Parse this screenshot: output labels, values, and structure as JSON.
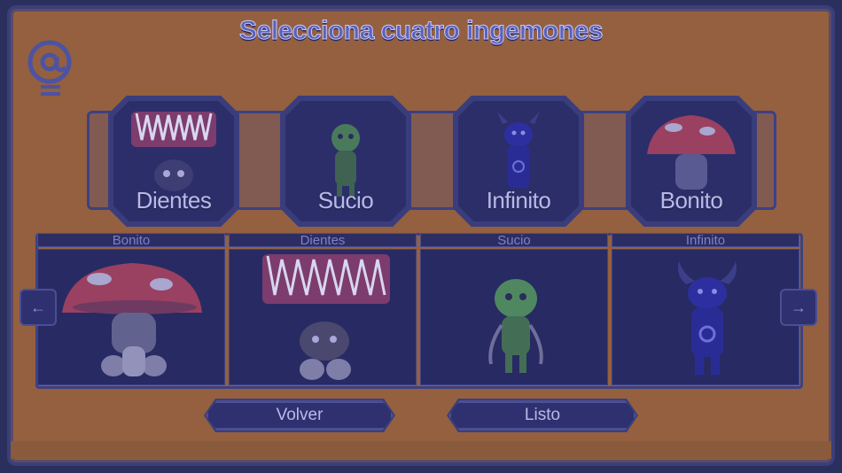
{
  "title": "Selecciona cuatro ingemones",
  "icons": {
    "top_left": "at-sign-icon",
    "prev": "arrow-left-icon",
    "next": "arrow-right-icon"
  },
  "selected": [
    {
      "label": "Dientes",
      "creature": "teeth-creature"
    },
    {
      "label": "Sucio",
      "creature": "green-creature"
    },
    {
      "label": "Infinito",
      "creature": "horned-creature"
    },
    {
      "label": "Bonito",
      "creature": "mushroom-creature"
    }
  ],
  "roster": [
    {
      "label": "Bonito",
      "creature": "mushroom-creature"
    },
    {
      "label": "Dientes",
      "creature": "teeth-creature"
    },
    {
      "label": "Sucio",
      "creature": "green-creature"
    },
    {
      "label": "Infinito",
      "creature": "horned-creature"
    }
  ],
  "nav": {
    "prev_label": "←",
    "next_label": "→"
  },
  "buttons": {
    "back": "Volver",
    "ready": "Listo"
  },
  "colors": {
    "panel": "#94603f",
    "frame": "#2a2f5e",
    "accent": "#3b4185",
    "text": "#b9b9e6"
  }
}
